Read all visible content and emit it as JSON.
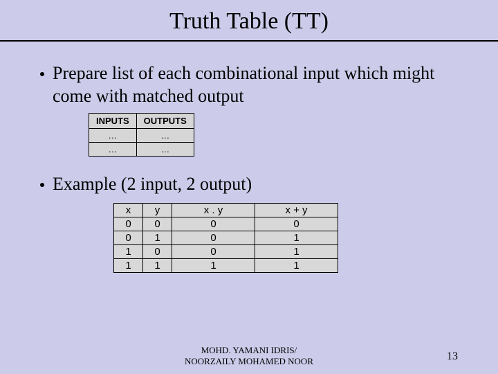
{
  "title": "Truth Table (TT)",
  "bullets": {
    "b1": "Prepare list of each combinational input which might come with matched output",
    "b2": "Example (2 input, 2 output)"
  },
  "small_table": {
    "h1": "INPUTS",
    "h2": "OUTPUTS",
    "r1c1": "…",
    "r1c2": "…",
    "r2c1": "…",
    "r2c2": "…"
  },
  "chart_data": {
    "type": "table",
    "columns": [
      "x",
      "y",
      "x . y",
      "x + y"
    ],
    "rows": [
      [
        0,
        0,
        0,
        0
      ],
      [
        0,
        1,
        0,
        1
      ],
      [
        1,
        0,
        0,
        1
      ],
      [
        1,
        1,
        1,
        1
      ]
    ]
  },
  "footer": {
    "l1": "MOHD. YAMANI IDRIS/",
    "l2": "NOORZAILY MOHAMED NOOR"
  },
  "page_num": "13"
}
